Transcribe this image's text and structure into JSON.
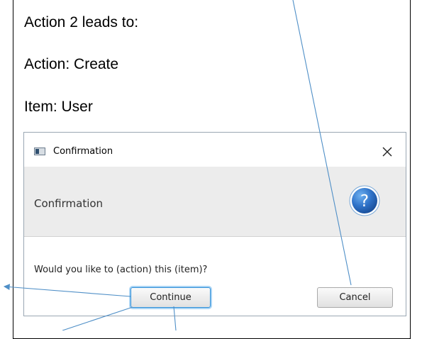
{
  "document": {
    "line1": "Action 2 leads to:",
    "line2": "Action: Create",
    "line3": "Item: User"
  },
  "dialog": {
    "title": "Confirmation",
    "close_symbol": "✕",
    "header_text": "Confirmation",
    "help_symbol": "?",
    "content_text": "Would you like to (action) this (item)?",
    "buttons": {
      "continue_label": "Continue",
      "cancel_label": "Cancel"
    }
  },
  "icons": [
    "app-window-icon",
    "close-icon",
    "question-icon"
  ],
  "colors": {
    "annotation_line": "#4f8fc7",
    "help_badge": "#2f73c9",
    "header_background": "#ececec",
    "focus_border": "#2f8fd8"
  }
}
